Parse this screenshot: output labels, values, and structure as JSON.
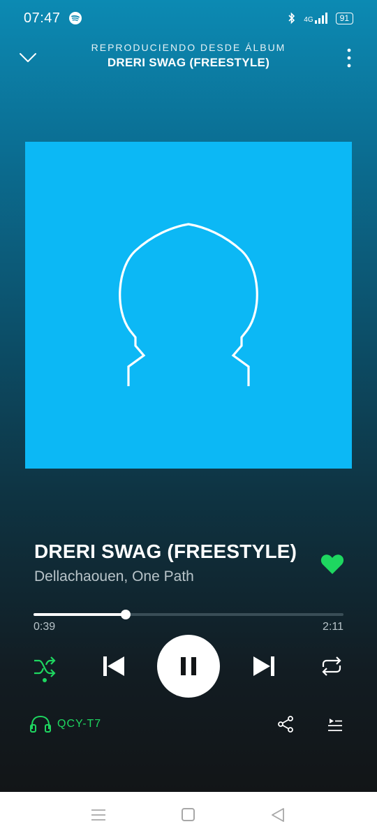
{
  "status_bar": {
    "time": "07:47",
    "network": "4G",
    "battery": "91",
    "icons": [
      "spotify-icon",
      "bluetooth-icon",
      "signal-icon",
      "battery-icon"
    ]
  },
  "header": {
    "subtitle": "REPRODUCIENDO DESDE ÁLBUM",
    "title": "DRERI SWAG (FREESTYLE)"
  },
  "track": {
    "title": "DRERI SWAG (FREESTYLE)",
    "artists": "Dellachaouen, One Path",
    "liked": true
  },
  "progress": {
    "elapsed": "0:39",
    "total": "2:11",
    "fraction": 0.2977
  },
  "controls": {
    "shuffle_active": true,
    "state": "playing"
  },
  "device": {
    "name": "QCY-T7"
  },
  "colors": {
    "accent": "#1ed760",
    "album_background": "#0cb8f5",
    "nav_icons": "#a7a7a7"
  }
}
